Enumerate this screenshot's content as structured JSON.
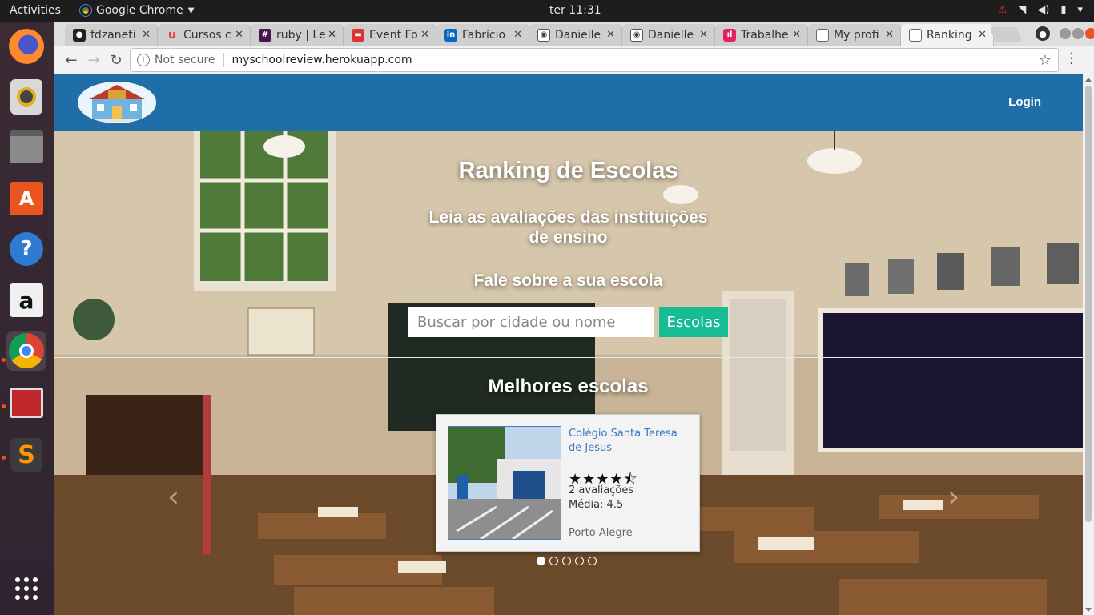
{
  "system": {
    "activities": "Activities",
    "app_name": "Google Chrome",
    "clock": "ter 11:31"
  },
  "tabs": [
    {
      "title": "fdzaneti",
      "favicon": "github-icon"
    },
    {
      "title": "Cursos c",
      "favicon": "udemy-icon"
    },
    {
      "title": "ruby | Le",
      "favicon": "slack-icon"
    },
    {
      "title": "Event Fo",
      "favicon": "bus-icon"
    },
    {
      "title": "Fabrício",
      "favicon": "linkedin-icon"
    },
    {
      "title": "Danielle",
      "favicon": "owl-icon"
    },
    {
      "title": "Danielle",
      "favicon": "owl-icon"
    },
    {
      "title": "Trabalhe",
      "favicon": "chart-icon"
    },
    {
      "title": "My profi",
      "favicon": "page-icon"
    },
    {
      "title": "Ranking",
      "favicon": "page-icon"
    }
  ],
  "omnibox": {
    "security": "Not secure",
    "url": "myschoolreview.herokuapp.com"
  },
  "site": {
    "login": "Login",
    "hero_title": "Ranking de Escolas",
    "hero_subtitle_line1": "Leia as avaliações das instituições",
    "hero_subtitle_line2": "de ensino",
    "cta": "Fale sobre a sua escola",
    "search_placeholder": "Buscar por cidade ou nome",
    "search_button": "Escolas",
    "best_title": "Melhores escolas"
  },
  "school_card": {
    "name": "Colégio Santa Teresa de Jesus",
    "rating": 4.5,
    "stars": "★★★★⯪",
    "reviews": "2 avaliações",
    "average": "Média: 4.5",
    "city": "Porto Alegre"
  },
  "carousel": {
    "prev": "‹",
    "next": "›",
    "active_index": 0,
    "count": 5
  },
  "colors": {
    "header": "#1f6ea8",
    "search_button": "#17bb94",
    "link": "#3a78c2"
  }
}
